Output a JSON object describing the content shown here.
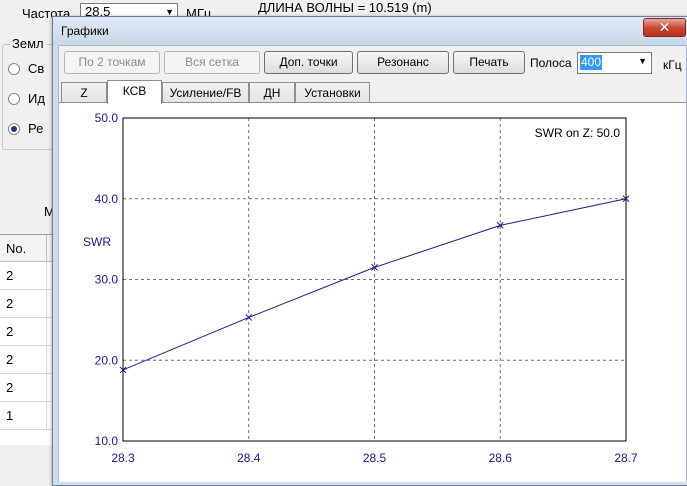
{
  "main": {
    "freq_label": "Частота",
    "freq_value": "28.5",
    "freq_unit": "МГц",
    "wavelength": "ДЛИНА ВОЛНЫ = 10.519 (m)",
    "ground_title": "Земл",
    "radios": [
      {
        "label": "Св",
        "selected": false
      },
      {
        "label": "Ид",
        "selected": false
      },
      {
        "label": "Ре",
        "selected": true
      }
    ],
    "m_label": "М",
    "table_header": "No.",
    "table_rows": [
      "2",
      "2",
      "2",
      "2",
      "2",
      "1"
    ]
  },
  "window": {
    "title": "Графики",
    "close_label": "✕",
    "toolbar": {
      "by2_label": "По 2 точкам",
      "grid_label": "Вся сетка",
      "extra_points_label": "Доп. точки",
      "resonance_label": "Резонанс",
      "print_label": "Печать",
      "band_label": "Полоса",
      "band_value": "400",
      "band_unit": "кГц"
    },
    "tabs": [
      {
        "label": "Z",
        "active": false
      },
      {
        "label": "КСВ",
        "active": true
      },
      {
        "label": "Усиление/FB",
        "active": false
      },
      {
        "label": "ДН",
        "active": false
      },
      {
        "label": "Установки",
        "active": false
      }
    ]
  },
  "colors": {
    "series": "#1a1a8c",
    "axis_text": "#1a1a8c",
    "grid": "#707070"
  },
  "chart_data": {
    "type": "line",
    "title": "",
    "annotation": "SWR on Z: 50.0",
    "xlabel": "",
    "ylabel": "SWR",
    "xlim": [
      28.3,
      28.7
    ],
    "ylim": [
      10.0,
      50.0
    ],
    "x_ticks": [
      "28.3",
      "28.4",
      "28.5",
      "28.6",
      "28.7"
    ],
    "y_ticks": [
      "10.0",
      "20.0",
      "30.0",
      "40.0",
      "50.0"
    ],
    "grid": true,
    "marker": "x",
    "series": [
      {
        "x": [
          28.3,
          28.4,
          28.5,
          28.6,
          28.7
        ],
        "y": [
          18.8,
          25.3,
          31.5,
          36.7,
          40.0
        ]
      }
    ]
  }
}
